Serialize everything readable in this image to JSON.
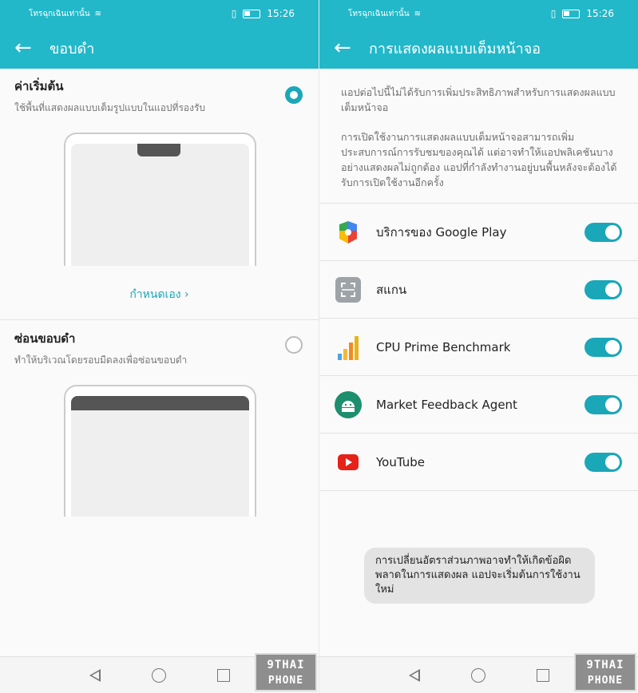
{
  "status": {
    "carrier": "โทรฉุกเฉินเท่านั้น",
    "time": "15:26"
  },
  "left": {
    "appbar_title": "ขอบดำ",
    "option_default": {
      "title": "ค่าเริ่มต้น",
      "subtitle": "ใช้พื้นที่แสดงผลแบบเต็มรูปแบบในแอปที่รองรับ",
      "selected": true
    },
    "custom_link": "กำหนดเอง",
    "option_hide": {
      "title": "ซ่อนขอบดำ",
      "subtitle": "ทำให้บริเวณโดยรอบมืดลงเพื่อซ่อนขอบดำ",
      "selected": false
    }
  },
  "right": {
    "appbar_title": "การแสดงผลแบบเต็มหน้าจอ",
    "info1": "แอปต่อไปนี้ไม่ได้รับการเพิ่มประสิทธิภาพสำหรับการแสดงผลแบบเต็มหน้าจอ",
    "info2": "การเปิดใช้งานการแสดงผลแบบเต็มหน้าจอสามารถเพิ่มประสบการณ์การรับชมของคุณได้ แต่อาจทำให้แอปพลิเคชันบางอย่างแสดงผลไม่ถูกต้อง แอปที่กำลังทำงานอยู่บนพื้นหลังจะต้องได้รับการเปิดใช้งานอีกครั้ง",
    "apps": [
      {
        "name": "บริการของ Google Play",
        "icon": "google-play-services-icon",
        "enabled": true
      },
      {
        "name": "สแกน",
        "icon": "scan-icon",
        "enabled": true
      },
      {
        "name": "CPU Prime Benchmark",
        "icon": "cpu-benchmark-icon",
        "enabled": true
      },
      {
        "name": "Market Feedback Agent",
        "icon": "android-icon",
        "enabled": true
      },
      {
        "name": "YouTube",
        "icon": "youtube-icon",
        "enabled": true
      }
    ],
    "toast": "การเปลี่ยนอัตราส่วนภาพอาจทำให้เกิดข้อผิดพลาดในการแสดงผล แอปจะเริ่มต้นการใช้งานใหม่"
  },
  "watermark": {
    "line1": "9THAI",
    "line2": "PHONE"
  },
  "colors": {
    "accent": "#22b8c9",
    "toggle": "#1aa7b8"
  }
}
